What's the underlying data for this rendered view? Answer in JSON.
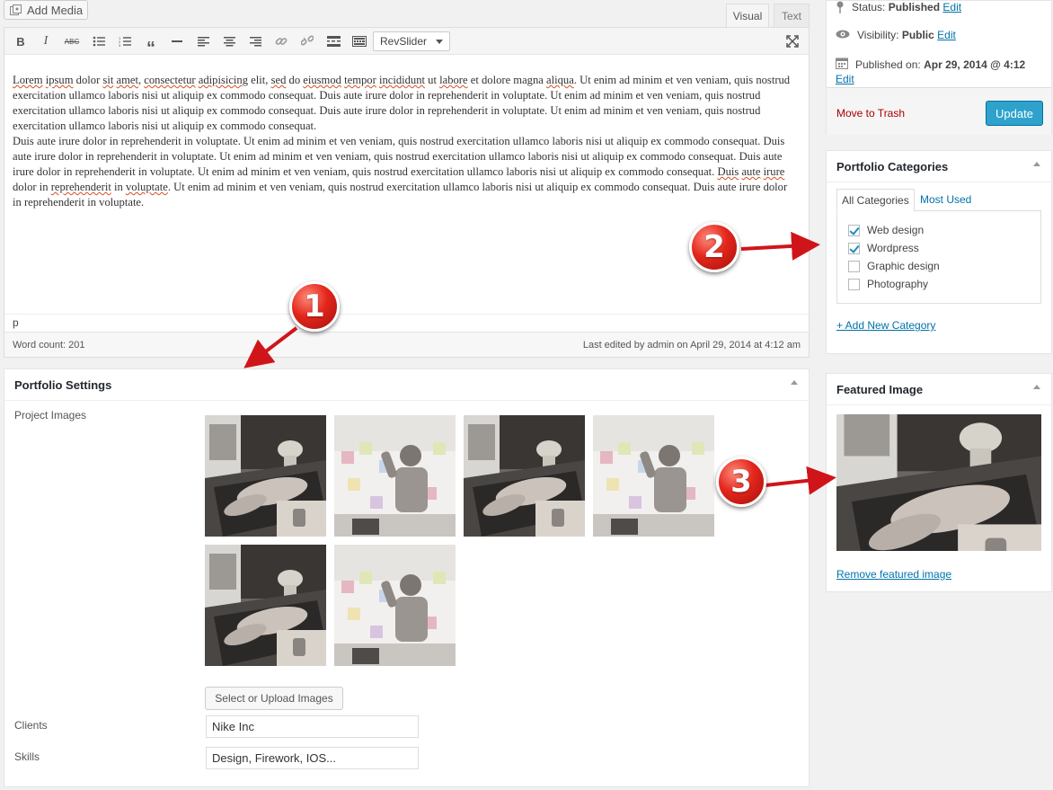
{
  "toolbar": {
    "add_media": "Add Media",
    "tab_visual": "Visual",
    "tab_text": "Text",
    "revslider": "RevSlider",
    "buttons": [
      "bold-icon",
      "italic-icon",
      "strikethrough-icon",
      "bullet-list-icon",
      "numbered-list-icon",
      "blockquote-icon",
      "horizontal-rule-icon",
      "align-left-icon",
      "align-center-icon",
      "align-right-icon",
      "insert-link-icon",
      "remove-link-icon",
      "read-more-icon",
      "toolbar-toggle-icon"
    ]
  },
  "editor": {
    "content": {
      "p1_misspelled": [
        "Lorem",
        "ipsum",
        "sit",
        "amet",
        "consectetur",
        "adipisicing",
        "sed",
        "eiusmod",
        "tempor",
        "incididunt",
        "labore",
        "aliqua"
      ],
      "line1": "Lorem ipsum dolor sit amet, consectetur adipisicing elit, sed do eiusmod tempor incididunt ut labore et dolore magna aliqua. Ut enim ad minim et ven veniam, quis nostrud exercitation ullamco laboris nisi ut aliquip ex commodo consequat. Duis aute irure dolor in reprehenderit in voluptate. Ut enim ad minim et ven veniam, quis nostrud exercitation ullamco laboris nisi ut aliquip ex commodo consequat. Duis aute irure dolor in reprehenderit in voluptate. Ut enim ad minim et ven veniam, quis nostrud exercitation ullamco laboris nisi ut aliquip ex commodo consequat.",
      "p2": "Duis aute irure dolor in reprehenderit in voluptate. Ut enim ad minim et ven veniam, quis nostrud exercitation ullamco laboris nisi ut aliquip ex commodo consequat. Duis aute irure dolor in reprehenderit in voluptate. Ut enim ad minim et ven veniam, quis nostrud exercitation ullamco laboris nisi ut aliquip ex commodo consequat. Duis aute irure dolor in reprehenderit in voluptate. Ut enim ad minim et ven veniam, quis nostrud exercitation ullamco laboris nisi ut aliquip ex commodo consequat. Duis aute irure dolor in reprehenderit in voluptate. Ut enim ad minim et ven veniam, quis nostrud exercitation ullamco laboris nisi ut aliquip ex commodo consequat. Duis aute irure dolor in reprehenderit in voluptate."
    },
    "path": "p",
    "word_count": "Word count: 201",
    "last_edited": "Last edited by admin on April 29, 2014 at 4:12 am"
  },
  "portfolio": {
    "title": "Portfolio Settings",
    "project_images_label": "Project Images",
    "upload_button": "Select or Upload Images",
    "clients_label": "Clients",
    "clients_value": "Nike Inc",
    "skills_label": "Skills",
    "skills_value": "Design, Firework, IOS..."
  },
  "publish": {
    "status_label": "Status:",
    "status_value": "Published",
    "visibility_label": "Visibility:",
    "visibility_value": "Public",
    "published_label": "Published on:",
    "published_value": "Apr 29, 2014 @ 4:12",
    "edit": "Edit",
    "move_to_trash": "Move to Trash",
    "update": "Update"
  },
  "categories": {
    "title": "Portfolio Categories",
    "tab_all": "All Categories",
    "tab_most_used": "Most Used",
    "items": [
      {
        "label": "Web design",
        "checked": true
      },
      {
        "label": "Wordpress",
        "checked": true
      },
      {
        "label": "Graphic design",
        "checked": false
      },
      {
        "label": "Photography",
        "checked": false
      }
    ],
    "add_new": "+ Add New Category"
  },
  "featured": {
    "title": "Featured Image",
    "remove": "Remove featured image"
  },
  "callouts": [
    "1",
    "2",
    "3"
  ],
  "colors": {
    "accent": "#2ea2cc",
    "link": "#0073aa",
    "trash": "#aa0000",
    "callout": "#e3261c"
  }
}
